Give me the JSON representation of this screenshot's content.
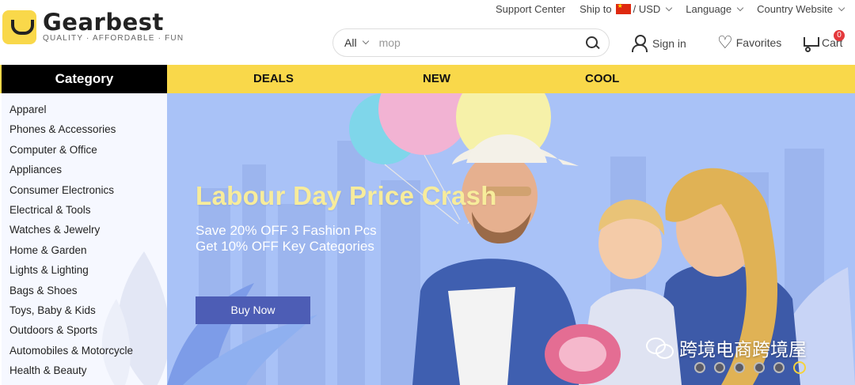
{
  "logo": {
    "name": "Gearbest",
    "tagline": "QUALITY · AFFORDABLE · FUN"
  },
  "topbar": {
    "support": "Support Center",
    "ship_to": "Ship to",
    "currency": "/ USD",
    "language": "Language",
    "country": "Country Website"
  },
  "search": {
    "category": "All",
    "value": "mop"
  },
  "account": {
    "signin": "Sign in",
    "favorites": "Favorites",
    "cart": "Cart",
    "cart_count": "0"
  },
  "nav": {
    "category": "Category",
    "links": [
      "DEALS",
      "NEW",
      "COOL"
    ]
  },
  "sidebar": {
    "items": [
      "Apparel",
      "Phones & Accessories",
      "Computer & Office",
      "Appliances",
      "Consumer Electronics",
      "Electrical & Tools",
      "Watches & Jewelry",
      "Home & Garden",
      "Lights & Lighting",
      "Bags & Shoes",
      "Toys, Baby & Kids",
      "Outdoors & Sports",
      "Automobiles & Motorcycle",
      "Health & Beauty"
    ]
  },
  "banner": {
    "title": "Labour Day Price Crash",
    "line1": "Save 20% OFF 3 Fashion Pcs",
    "line2": "Get 10% OFF Key Categories",
    "button": "Buy Now",
    "slide_count": 6,
    "active_slide": 6,
    "watermark": "跨境电商跨境屋"
  },
  "colors": {
    "brand_yellow": "#f9d84a",
    "nav_black": "#000000",
    "button_blue": "#4d5db5",
    "title_yellow": "#f7ec9b",
    "banner_bg": "#a9c2f7"
  },
  "icons": [
    "search-icon",
    "user-icon",
    "heart-icon",
    "cart-icon",
    "chevron-down-icon",
    "flag-cn-icon",
    "wechat-icon"
  ]
}
